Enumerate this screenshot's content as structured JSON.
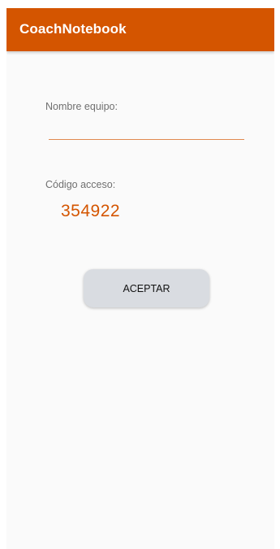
{
  "app_bar": {
    "title": "CoachNotebook",
    "color": "#d45500"
  },
  "form": {
    "team_name": {
      "label": "Nombre equipo:",
      "value": "",
      "placeholder": ""
    },
    "access_code": {
      "label": "Código acceso:",
      "value": "354922"
    },
    "accept_label": "ACEPTAR"
  },
  "colors": {
    "accent": "#d45500",
    "button_bg": "#d9dce1",
    "label_text": "#707070"
  }
}
